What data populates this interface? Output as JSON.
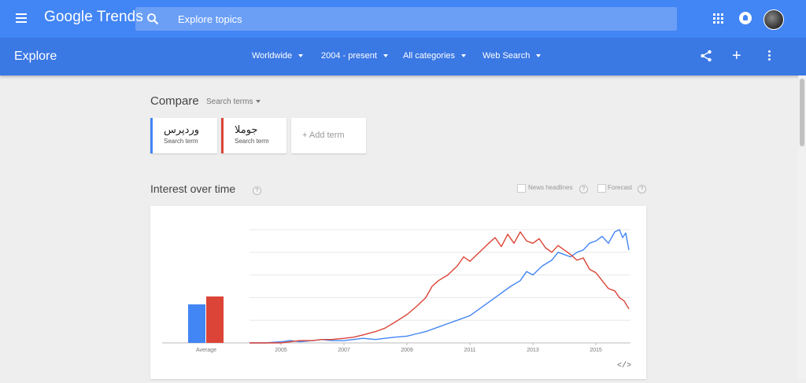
{
  "header": {
    "brand": "Google Trends",
    "search_placeholder": "Explore topics"
  },
  "subbar": {
    "title": "Explore",
    "filters": [
      "Worldwide",
      "2004 - present",
      "All categories",
      "Web Search"
    ]
  },
  "compare": {
    "label": "Compare",
    "mode": "Search terms",
    "terms": [
      {
        "name": "وردپرس",
        "sub": "Search term",
        "color": "#4285f4"
      },
      {
        "name": "جوملا",
        "sub": "Search term",
        "color": "#db4437"
      }
    ],
    "add_label": "+ Add term"
  },
  "interest": {
    "title": "Interest over time",
    "news_headlines": "News headlines",
    "forecast": "Forecast",
    "embed": "</>"
  },
  "chart_data": {
    "type": "line",
    "average_label": "Average",
    "averages": [
      {
        "name": "وردپرس",
        "value": 34,
        "color": "#4285f4"
      },
      {
        "name": "جوملا",
        "value": 41,
        "color": "#db4437"
      }
    ],
    "x_ticks": [
      "2005",
      "2007",
      "2009",
      "2011",
      "2013",
      "2015"
    ],
    "xlim": [
      2004,
      2016.1
    ],
    "ylim": [
      0,
      100
    ],
    "grid": true,
    "series": [
      {
        "name": "وردپرس",
        "color": "#4285f4",
        "points": [
          [
            2004.0,
            0
          ],
          [
            2004.5,
            0
          ],
          [
            2005.0,
            1
          ],
          [
            2005.3,
            2
          ],
          [
            2005.6,
            1
          ],
          [
            2006.0,
            2
          ],
          [
            2006.3,
            3
          ],
          [
            2006.6,
            2
          ],
          [
            2007.0,
            2
          ],
          [
            2007.3,
            3
          ],
          [
            2007.6,
            4
          ],
          [
            2008.0,
            3
          ],
          [
            2008.3,
            4
          ],
          [
            2008.6,
            5
          ],
          [
            2009.0,
            6
          ],
          [
            2009.3,
            8
          ],
          [
            2009.6,
            10
          ],
          [
            2010.0,
            14
          ],
          [
            2010.3,
            17
          ],
          [
            2010.6,
            20
          ],
          [
            2011.0,
            24
          ],
          [
            2011.3,
            30
          ],
          [
            2011.6,
            36
          ],
          [
            2011.8,
            40
          ],
          [
            2012.0,
            44
          ],
          [
            2012.3,
            50
          ],
          [
            2012.6,
            55
          ],
          [
            2012.8,
            63
          ],
          [
            2013.0,
            60
          ],
          [
            2013.3,
            68
          ],
          [
            2013.6,
            73
          ],
          [
            2013.8,
            80
          ],
          [
            2014.0,
            78
          ],
          [
            2014.2,
            76
          ],
          [
            2014.4,
            80
          ],
          [
            2014.6,
            82
          ],
          [
            2014.8,
            88
          ],
          [
            2015.0,
            90
          ],
          [
            2015.2,
            94
          ],
          [
            2015.4,
            88
          ],
          [
            2015.6,
            98
          ],
          [
            2015.75,
            100
          ],
          [
            2015.85,
            93
          ],
          [
            2015.95,
            97
          ],
          [
            2016.05,
            82
          ]
        ]
      },
      {
        "name": "جوملا",
        "color": "#db4437",
        "points": [
          [
            2004.0,
            0
          ],
          [
            2004.5,
            0
          ],
          [
            2005.0,
            0
          ],
          [
            2005.3,
            1
          ],
          [
            2005.6,
            2
          ],
          [
            2006.0,
            2
          ],
          [
            2006.3,
            3
          ],
          [
            2006.6,
            3
          ],
          [
            2007.0,
            4
          ],
          [
            2007.3,
            5
          ],
          [
            2007.6,
            7
          ],
          [
            2008.0,
            10
          ],
          [
            2008.3,
            13
          ],
          [
            2008.6,
            18
          ],
          [
            2009.0,
            25
          ],
          [
            2009.3,
            32
          ],
          [
            2009.6,
            40
          ],
          [
            2009.8,
            50
          ],
          [
            2010.0,
            55
          ],
          [
            2010.3,
            60
          ],
          [
            2010.6,
            68
          ],
          [
            2010.8,
            76
          ],
          [
            2011.0,
            72
          ],
          [
            2011.3,
            80
          ],
          [
            2011.6,
            88
          ],
          [
            2011.8,
            93
          ],
          [
            2012.0,
            85
          ],
          [
            2012.2,
            96
          ],
          [
            2012.4,
            88
          ],
          [
            2012.6,
            98
          ],
          [
            2012.8,
            90
          ],
          [
            2013.0,
            88
          ],
          [
            2013.2,
            92
          ],
          [
            2013.4,
            84
          ],
          [
            2013.6,
            80
          ],
          [
            2013.8,
            86
          ],
          [
            2014.0,
            82
          ],
          [
            2014.2,
            78
          ],
          [
            2014.4,
            73
          ],
          [
            2014.6,
            75
          ],
          [
            2014.8,
            65
          ],
          [
            2015.0,
            62
          ],
          [
            2015.2,
            55
          ],
          [
            2015.4,
            48
          ],
          [
            2015.6,
            46
          ],
          [
            2015.75,
            40
          ],
          [
            2015.9,
            37
          ],
          [
            2016.05,
            30
          ]
        ]
      }
    ]
  }
}
